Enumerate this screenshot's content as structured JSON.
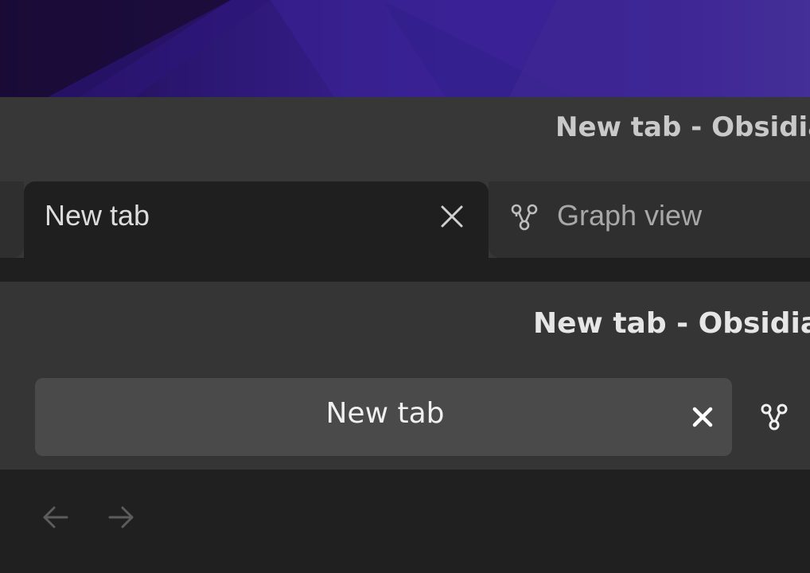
{
  "window_back": {
    "title": "New tab - Obsidia",
    "tabs": [
      {
        "label": "New tab",
        "active": true,
        "close_icon": "close-icon"
      },
      {
        "label": "Graph view",
        "active": false,
        "icon": "graph-view-icon"
      }
    ]
  },
  "window_front": {
    "title": "New tab - Obsidia",
    "tabs": [
      {
        "label": "New tab",
        "active": true,
        "close_icon": "close-icon"
      },
      {
        "label": "",
        "active": false,
        "icon": "graph-view-icon"
      }
    ]
  },
  "navigation": {
    "back_icon": "arrow-left-icon",
    "forward_icon": "arrow-right-icon"
  },
  "colors": {
    "wallpaper_accent": "#3a2192",
    "titlebar_bg": "#373737",
    "active_tab_bg": "#1f1f1f",
    "front_active_tab_bg": "#4a4a4a",
    "nav_bg": "#202020"
  }
}
